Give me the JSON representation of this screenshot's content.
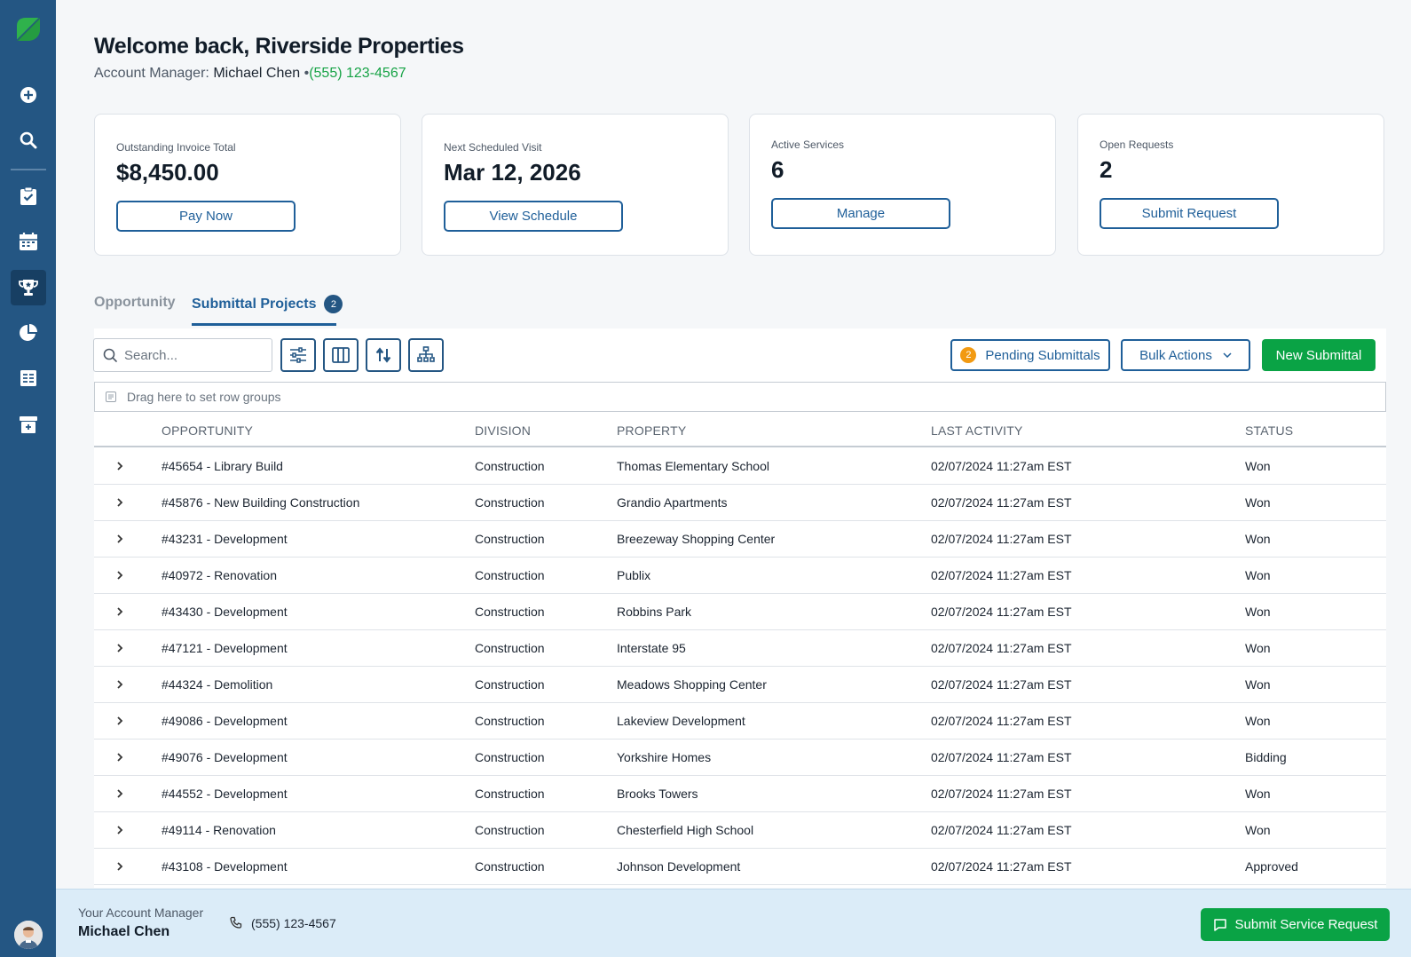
{
  "header": {
    "welcome": "Welcome back, Riverside Properties",
    "manager_label": "Account Manager:",
    "manager_name": "Michael Chen",
    "separator": "•",
    "manager_phone": "(555) 123-4567"
  },
  "cards": [
    {
      "label": "Outstanding Invoice Total",
      "value": "$8,450.00",
      "button": "Pay Now"
    },
    {
      "label": "Next Scheduled Visit",
      "value": "Mar 12, 2026",
      "button": "View Schedule"
    },
    {
      "label": "Active Services",
      "value": "6",
      "button": "Manage"
    },
    {
      "label": "Open Requests",
      "value": "2",
      "button": "Submit Request"
    }
  ],
  "tabs": {
    "opportunity": "Opportunity",
    "submittal_projects": "Submittal Projects",
    "submittal_count": "2"
  },
  "toolbar": {
    "search_placeholder": "Search...",
    "pending_label": "Pending Submittals",
    "pending_count": "2",
    "bulk_label": "Bulk Actions",
    "new_label": "New Submittal"
  },
  "group_bar": {
    "text": "Drag here to set row groups"
  },
  "table": {
    "columns": [
      "OPPORTUNITY",
      "DIVISION",
      "PROPERTY",
      "LAST ACTIVITY",
      "STATUS"
    ],
    "rows": [
      [
        "#45654 - Library Build",
        "Construction",
        "Thomas Elementary School",
        "02/07/2024 11:27am EST",
        "Won"
      ],
      [
        "#45876 - New Building Construction",
        "Construction",
        "Grandio Apartments",
        "02/07/2024 11:27am EST",
        "Won"
      ],
      [
        "#43231 - Development",
        "Construction",
        "Breezeway Shopping Center",
        "02/07/2024 11:27am EST",
        "Won"
      ],
      [
        "#40972 - Renovation",
        "Construction",
        "Publix",
        "02/07/2024 11:27am EST",
        "Won"
      ],
      [
        "#43430 - Development",
        "Construction",
        "Robbins Park",
        "02/07/2024 11:27am EST",
        "Won"
      ],
      [
        "#47121 - Development",
        "Construction",
        "Interstate 95",
        "02/07/2024 11:27am EST",
        "Won"
      ],
      [
        "#44324 - Demolition",
        "Construction",
        "Meadows Shopping Center",
        "02/07/2024 11:27am EST",
        "Won"
      ],
      [
        "#49086 - Development",
        "Construction",
        "Lakeview Development",
        "02/07/2024 11:27am EST",
        "Won"
      ],
      [
        "#49076 - Development",
        "Construction",
        "Yorkshire Homes",
        "02/07/2024 11:27am EST",
        "Bidding"
      ],
      [
        "#44552 - Development",
        "Construction",
        "Brooks Towers",
        "02/07/2024 11:27am EST",
        "Won"
      ],
      [
        "#49114 - Renovation",
        "Construction",
        "Chesterfield High School",
        "02/07/2024 11:27am EST",
        "Won"
      ],
      [
        "#43108 - Development",
        "Construction",
        "Johnson Development",
        "02/07/2024 11:27am EST",
        "Approved"
      ]
    ]
  },
  "footer": {
    "label": "Your Account Manager",
    "name": "Michael Chen",
    "phone": "(555) 123-4567",
    "button": "Submit Service Request"
  },
  "sidebar": {
    "icons": [
      "logo-icon",
      "add-icon",
      "search-icon",
      "tasks-icon",
      "calendar-icon",
      "trophy-icon",
      "reports-icon",
      "invoices-icon",
      "archive-icon",
      "avatar"
    ],
    "active": "trophy-icon"
  },
  "colors": {
    "sidebar": "#245683",
    "accent_blue": "#1f5f99",
    "accent_green": "#0aa345",
    "badge_orange": "#f29a12",
    "footer_bg": "#dbecf8"
  }
}
